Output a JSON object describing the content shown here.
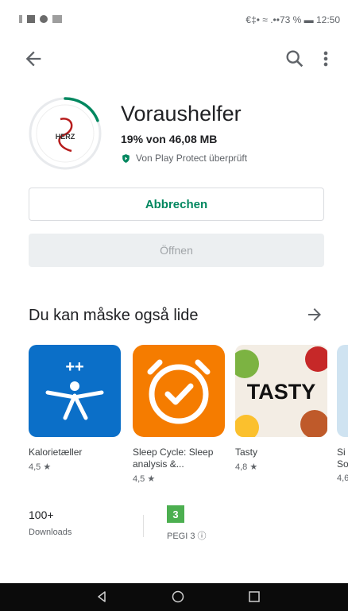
{
  "status_bar": {
    "right_text": "€‡• ≈ .••73 % ▬ 12:50"
  },
  "app": {
    "title": "Voraushelfer",
    "progress_text": "19% von 46,08 MB",
    "progress_fraction": 0.19,
    "icon_text": "HERZ",
    "protect_text": "Von Play Protect überprüft",
    "accent_color": "#01875f"
  },
  "buttons": {
    "cancel_label": "Abbrechen",
    "open_label": "Öffnen"
  },
  "section": {
    "title": "Du kan måske også lide"
  },
  "cards": [
    {
      "name": "Kalorietæller",
      "rating": "4,5 ★",
      "icon": "myfitnesspal-icon"
    },
    {
      "name": "Sleep Cycle: Sleep analysis &...",
      "rating": "4,5 ★",
      "icon": "alarm-clock-icon"
    },
    {
      "name": "Tasty",
      "rating": "4,8 ★",
      "icon": "tasty-icon",
      "icon_text": "TASTY"
    },
    {
      "name": "Si So",
      "rating": "4,6",
      "icon": "partial-app-icon"
    }
  ],
  "stats": {
    "downloads_value": "100+",
    "downloads_label": "Downloads",
    "pegi_value": "3",
    "pegi_label": "PEGI 3 ⓘ"
  }
}
